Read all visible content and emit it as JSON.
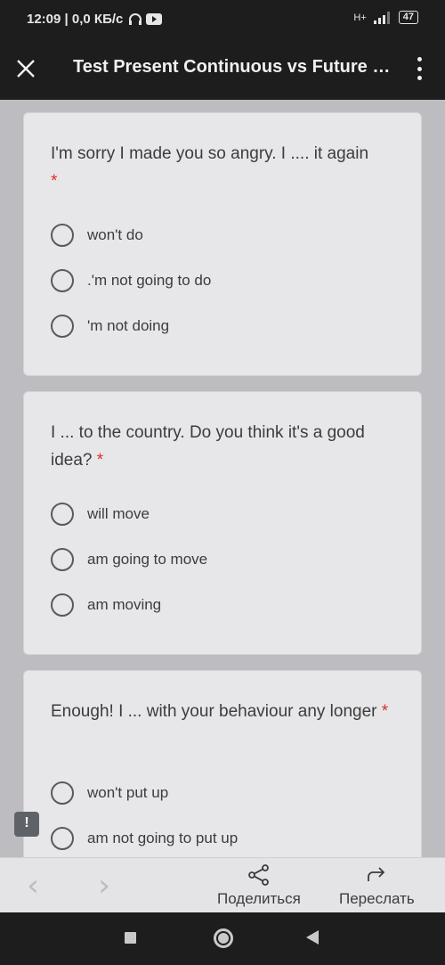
{
  "status_bar": {
    "time_speed": "12:09 | 0,0 КБ/с",
    "network": "H+",
    "battery": "47"
  },
  "app_bar": {
    "title": "Test Present Continuous vs Future Simple"
  },
  "questions": [
    {
      "text": "I'm sorry I made you so angry. I .... it again",
      "required_mark": "*",
      "options": [
        "won't do",
        ".'m not going to do",
        "'m not doing"
      ]
    },
    {
      "text": "I ... to the country. Do you think it's a good idea?",
      "required_mark": "*",
      "options": [
        "will move",
        "am going to move",
        "am moving"
      ]
    },
    {
      "text": "Enough! I ... with your behaviour any longer",
      "required_mark": "*",
      "options": [
        "won't put up",
        "am not going to put up"
      ]
    }
  ],
  "report": {
    "label": "!"
  },
  "bottom_bar": {
    "share_label": "Поделиться",
    "forward_label": "Переслать"
  },
  "colors": {
    "background": "#bdbcc0",
    "card": "#e7e7e9",
    "required": "#d93025",
    "dark_bar": "#1d1d1d"
  }
}
